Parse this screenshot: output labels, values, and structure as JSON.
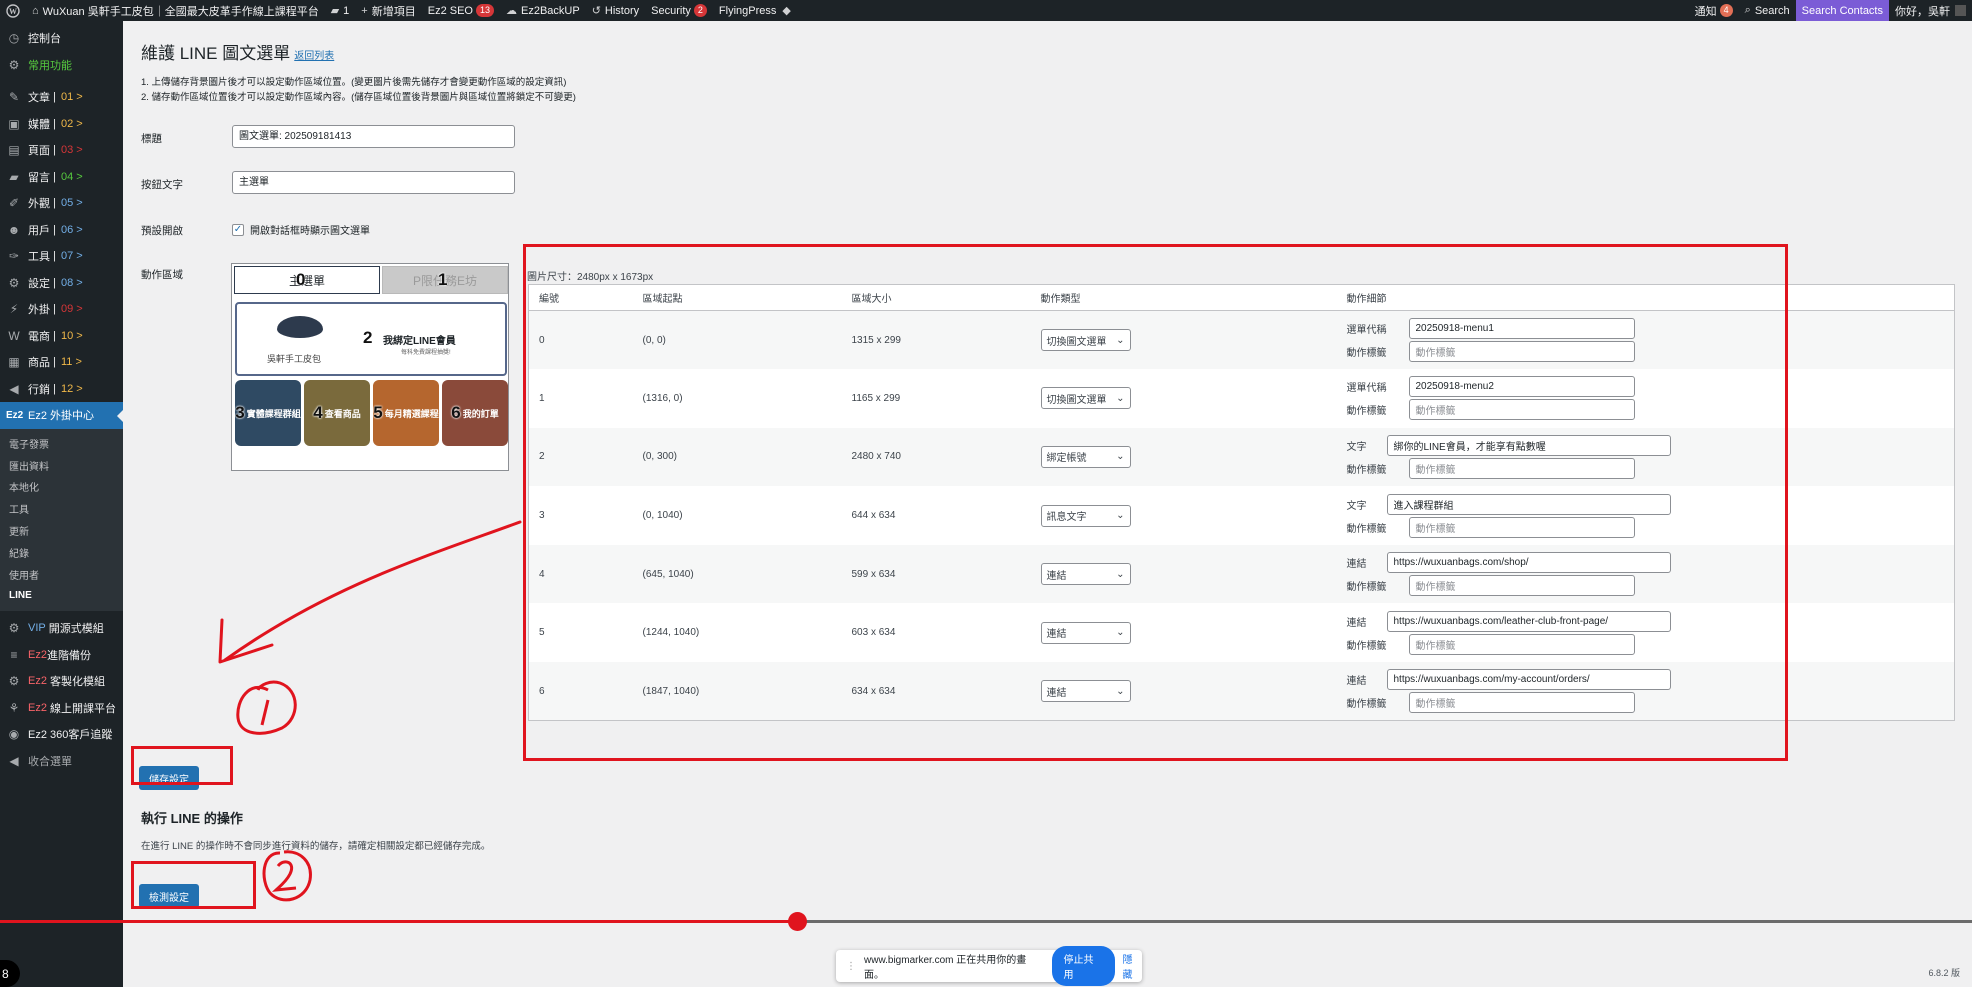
{
  "admin_bar": {
    "site_name": "WuXuan 吳軒手工皮包｜全國最大皮革手作線上課程平台",
    "comments_count": "1",
    "new_item": "新增項目",
    "seo": "Ez2 SEO",
    "seo_badge": "13",
    "backup": "Ez2BackUP",
    "history": "History",
    "security": "Security",
    "security_badge": "2",
    "flyingpress": "FlyingPress",
    "notifications": "通知",
    "notifications_badge": "4",
    "search": "Search",
    "search_contacts": "Search Contacts",
    "greeting": "你好，吳軒"
  },
  "sidebar": {
    "items": [
      {
        "label": "控制台",
        "num": ""
      },
      {
        "label": "常用功能",
        "num": ""
      },
      {
        "label": "文章",
        "num": "01 >"
      },
      {
        "label": "媒體",
        "num": "02 >"
      },
      {
        "label": "頁面",
        "num": "03 >"
      },
      {
        "label": "留言",
        "num": "04 >"
      },
      {
        "label": "外觀",
        "num": "05 >"
      },
      {
        "label": "用戶",
        "num": "06 >"
      },
      {
        "label": "工具",
        "num": "07 >"
      },
      {
        "label": "設定",
        "num": "08 >"
      },
      {
        "label": "外掛",
        "num": "09 >"
      },
      {
        "label": "電商",
        "num": "10 >"
      },
      {
        "label": "商品",
        "num": "11 >"
      },
      {
        "label": "行銷",
        "num": "12 >"
      },
      {
        "label": "Ez2 外掛中心",
        "num": ""
      }
    ],
    "sub_items": [
      "電子發票",
      "匯出資料",
      "本地化",
      "工具",
      "更新",
      "紀錄",
      "使用者",
      "LINE"
    ],
    "bottom_items": [
      {
        "prefix": "VIP",
        "label": "開源式模組"
      },
      {
        "prefix": "Ez2",
        "label": "進階備份"
      },
      {
        "prefix": "Ez2",
        "label": "客製化模組"
      },
      {
        "prefix": "Ez2",
        "label": "線上開課平台"
      },
      {
        "prefix": "",
        "label": "Ez2 360客戶追蹤"
      },
      {
        "prefix": "",
        "label": "收合選單"
      }
    ]
  },
  "page": {
    "title": "維護 LINE 圖文選單",
    "back_link": "返回列表",
    "note1": "1. 上傳儲存背景圖片後才可以設定動作區域位置。(變更圖片後需先儲存才會變更動作區域的設定資訊)",
    "note2": "2. 儲存動作區域位置後才可以設定動作區域內容。(儲存區域位置後背景圖片與區域位置將鎖定不可變更)",
    "label_title": "標題",
    "title_value": "圖文選單: 202509181413",
    "label_button_text": "按鈕文字",
    "button_text_value": "主選單",
    "label_default_open": "預設開啟",
    "default_open_text": "開啟對話框時顯示圖文選單",
    "label_action_area": "動作區域"
  },
  "preview": {
    "tab0": "主選單",
    "tab1": "P限任務E坊",
    "brand_name": "吳軒手工皮包",
    "banner_title": "我綁定LINE會員",
    "banner_sub": "每科免費課程抽獎!",
    "tiles": [
      "實體課程群組",
      "查看商品",
      "每月精選課程",
      "我的訂單"
    ],
    "tile_colors": [
      "#2f4a63",
      "#7a6a3c",
      "#b5662e",
      "#8a4a3a"
    ],
    "area_numbers": [
      "0",
      "1",
      "2",
      "3",
      "4",
      "5",
      "6"
    ]
  },
  "table": {
    "image_size": "圖片尺寸：2480px x 1673px",
    "headers": [
      "編號",
      "區域起點",
      "區域大小",
      "動作類型",
      "動作細節"
    ],
    "rows": [
      {
        "id": "0",
        "start": "(0, 0)",
        "size": "1315 x 299",
        "type": "切換圖文選單",
        "detail_label": "選單代稱",
        "detail_value": "20250918-menu1",
        "tag_label": "動作標籤",
        "tag_placeholder": "動作標籤"
      },
      {
        "id": "1",
        "start": "(1316, 0)",
        "size": "1165 x 299",
        "type": "切換圖文選單",
        "detail_label": "選單代稱",
        "detail_value": "20250918-menu2",
        "tag_label": "動作標籤",
        "tag_placeholder": "動作標籤"
      },
      {
        "id": "2",
        "start": "(0, 300)",
        "size": "2480 x 740",
        "type": "綁定帳號",
        "detail_label": "文字",
        "detail_value": "綁你的LINE會員，才能享有點數喔",
        "tag_label": "動作標籤",
        "tag_placeholder": "動作標籤"
      },
      {
        "id": "3",
        "start": "(0, 1040)",
        "size": "644 x 634",
        "type": "訊息文字",
        "detail_label": "文字",
        "detail_value": "進入課程群組",
        "tag_label": "動作標籤",
        "tag_placeholder": "動作標籤"
      },
      {
        "id": "4",
        "start": "(645, 1040)",
        "size": "599 x 634",
        "type": "連結",
        "detail_label": "連結",
        "detail_value": "https://wuxuanbags.com/shop/",
        "tag_label": "動作標籤",
        "tag_placeholder": "動作標籤"
      },
      {
        "id": "5",
        "start": "(1244, 1040)",
        "size": "603 x 634",
        "type": "連結",
        "detail_label": "連結",
        "detail_value": "https://wuxuanbags.com/leather-club-front-page/",
        "tag_label": "動作標籤",
        "tag_placeholder": "動作標籤"
      },
      {
        "id": "6",
        "start": "(1847, 1040)",
        "size": "634 x 634",
        "type": "連結",
        "detail_label": "連結",
        "detail_value": "https://wuxuanbags.com/my-account/orders/",
        "tag_label": "動作標籤",
        "tag_placeholder": "動作標籤"
      }
    ]
  },
  "save_button": "儲存設定",
  "line_section": {
    "title": "執行 LINE 的操作",
    "note": "在進行 LINE 的操作時不會同步進行資料的儲存，請確定相關設定都已經儲存完成。",
    "check_button": "檢測設定"
  },
  "share_bar": {
    "message": "www.bigmarker.com 正在共用你的畫面。",
    "stop": "停止共用",
    "hide": "隱藏"
  },
  "version": "6.8.2 版",
  "corner_label": "8",
  "video_progress": 0.404,
  "colors": {
    "accent": "#2271b1",
    "annotation": "#e0141e",
    "admin_bg": "#1d2327"
  }
}
